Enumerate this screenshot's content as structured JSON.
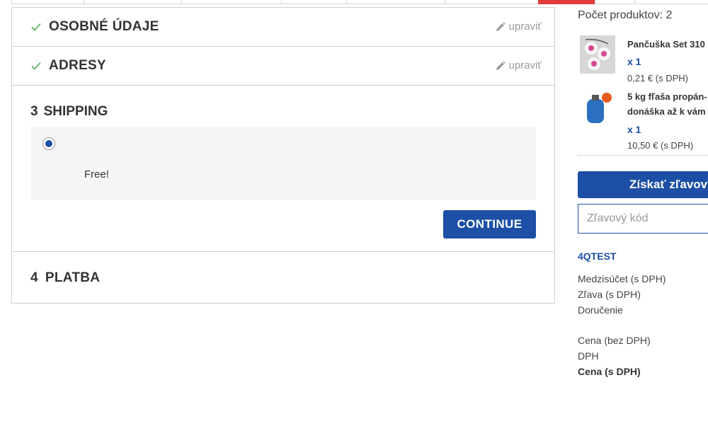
{
  "checkout": {
    "steps": [
      {
        "title": "OSOBNÉ ÚDAJE",
        "edit_label": "upraviť"
      },
      {
        "title": "ADRESY",
        "edit_label": "upraviť"
      }
    ],
    "shipping": {
      "number": "3",
      "title": "SHIPPING",
      "price": "Free!",
      "continue_label": "CONTINUE"
    },
    "payment": {
      "number": "4",
      "title": "PLATBA"
    }
  },
  "cart": {
    "count_label": "Počet produktov: 2",
    "products": [
      {
        "name": "Pančuška Set 310",
        "qty": "x 1",
        "price": "0,21 € (s DPH)"
      },
      {
        "name_line1": "5 kg fľaša propán-",
        "name_line2": "donáška až k vám",
        "qty": "x 1",
        "price": "10,50 € (s DPH)"
      }
    ],
    "voucher_button": "Získať zľavový",
    "voucher_placeholder": "Zľavový kód",
    "voucher_code": "4QTEST",
    "totals": {
      "subtotal": "Medzisúčet (s DPH)",
      "discount": "Zľava (s DPH)",
      "shipping": "Doručenie",
      "without_vat": "Cena (bez DPH)",
      "vat": "DPH",
      "with_vat": "Cena (s DPH)"
    }
  },
  "colors": {
    "accent": "#1c4fa5",
    "check": "#4caf50",
    "active_tab": "#e03a3a"
  }
}
